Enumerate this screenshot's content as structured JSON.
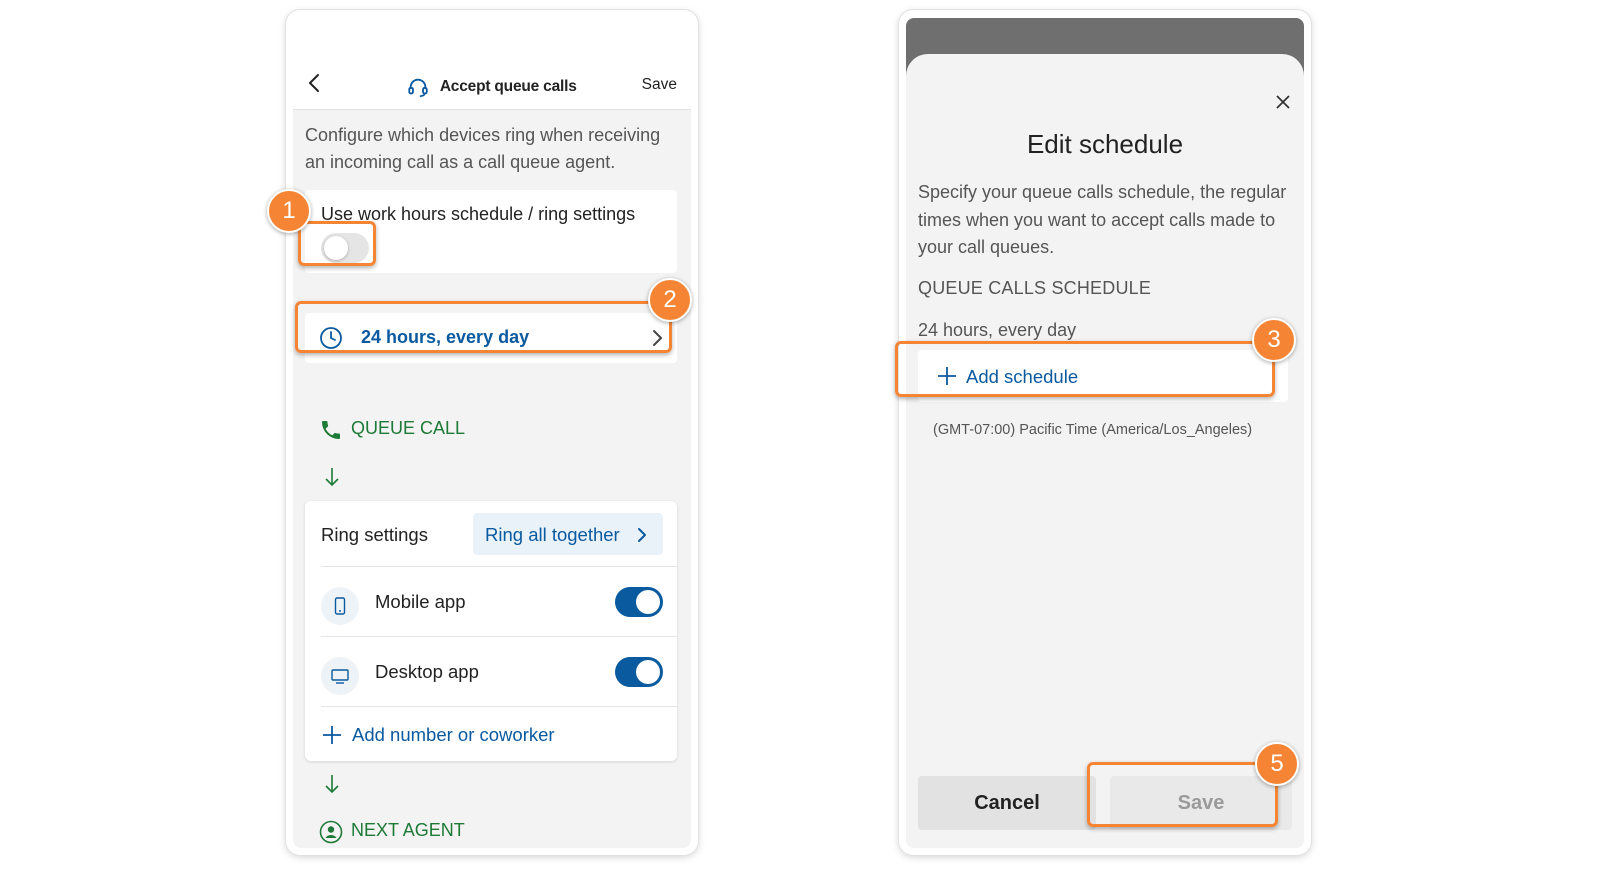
{
  "left_screen": {
    "header": {
      "title": "Accept queue calls",
      "save_label": "Save"
    },
    "description": "Configure which devices ring when receiving an incoming call as a call queue agent.",
    "work_hours": {
      "label": "Use work hours schedule / ring settings",
      "enabled": false
    },
    "schedule": {
      "value": "24 hours, every day"
    },
    "queue_call_label": "QUEUE CALL",
    "ring_settings": {
      "label": "Ring settings",
      "mode": "Ring all together"
    },
    "devices": [
      {
        "label": "Mobile app",
        "enabled": true
      },
      {
        "label": "Desktop app",
        "enabled": true
      }
    ],
    "add_number_label": "Add number or coworker",
    "next_agent_label": "NEXT AGENT"
  },
  "right_screen": {
    "title": "Edit schedule",
    "description": "Specify your queue calls schedule, the regular times when you want to accept calls made to your call queues.",
    "schedule_heading": "QUEUE CALLS SCHEDULE",
    "schedule_value": "24 hours, every day",
    "add_schedule_label": "Add schedule",
    "timezone": "(GMT-07:00) Pacific Time (America/Los_Angeles)",
    "cancel_label": "Cancel",
    "save_label": "Save"
  },
  "annotations": {
    "badges": [
      "1",
      "2",
      "3",
      "5"
    ],
    "color": "#f58534"
  },
  "colors": {
    "accent_blue": "#0a5aa0",
    "queue_green": "#1e7a37",
    "background": "#f3f3f3"
  }
}
